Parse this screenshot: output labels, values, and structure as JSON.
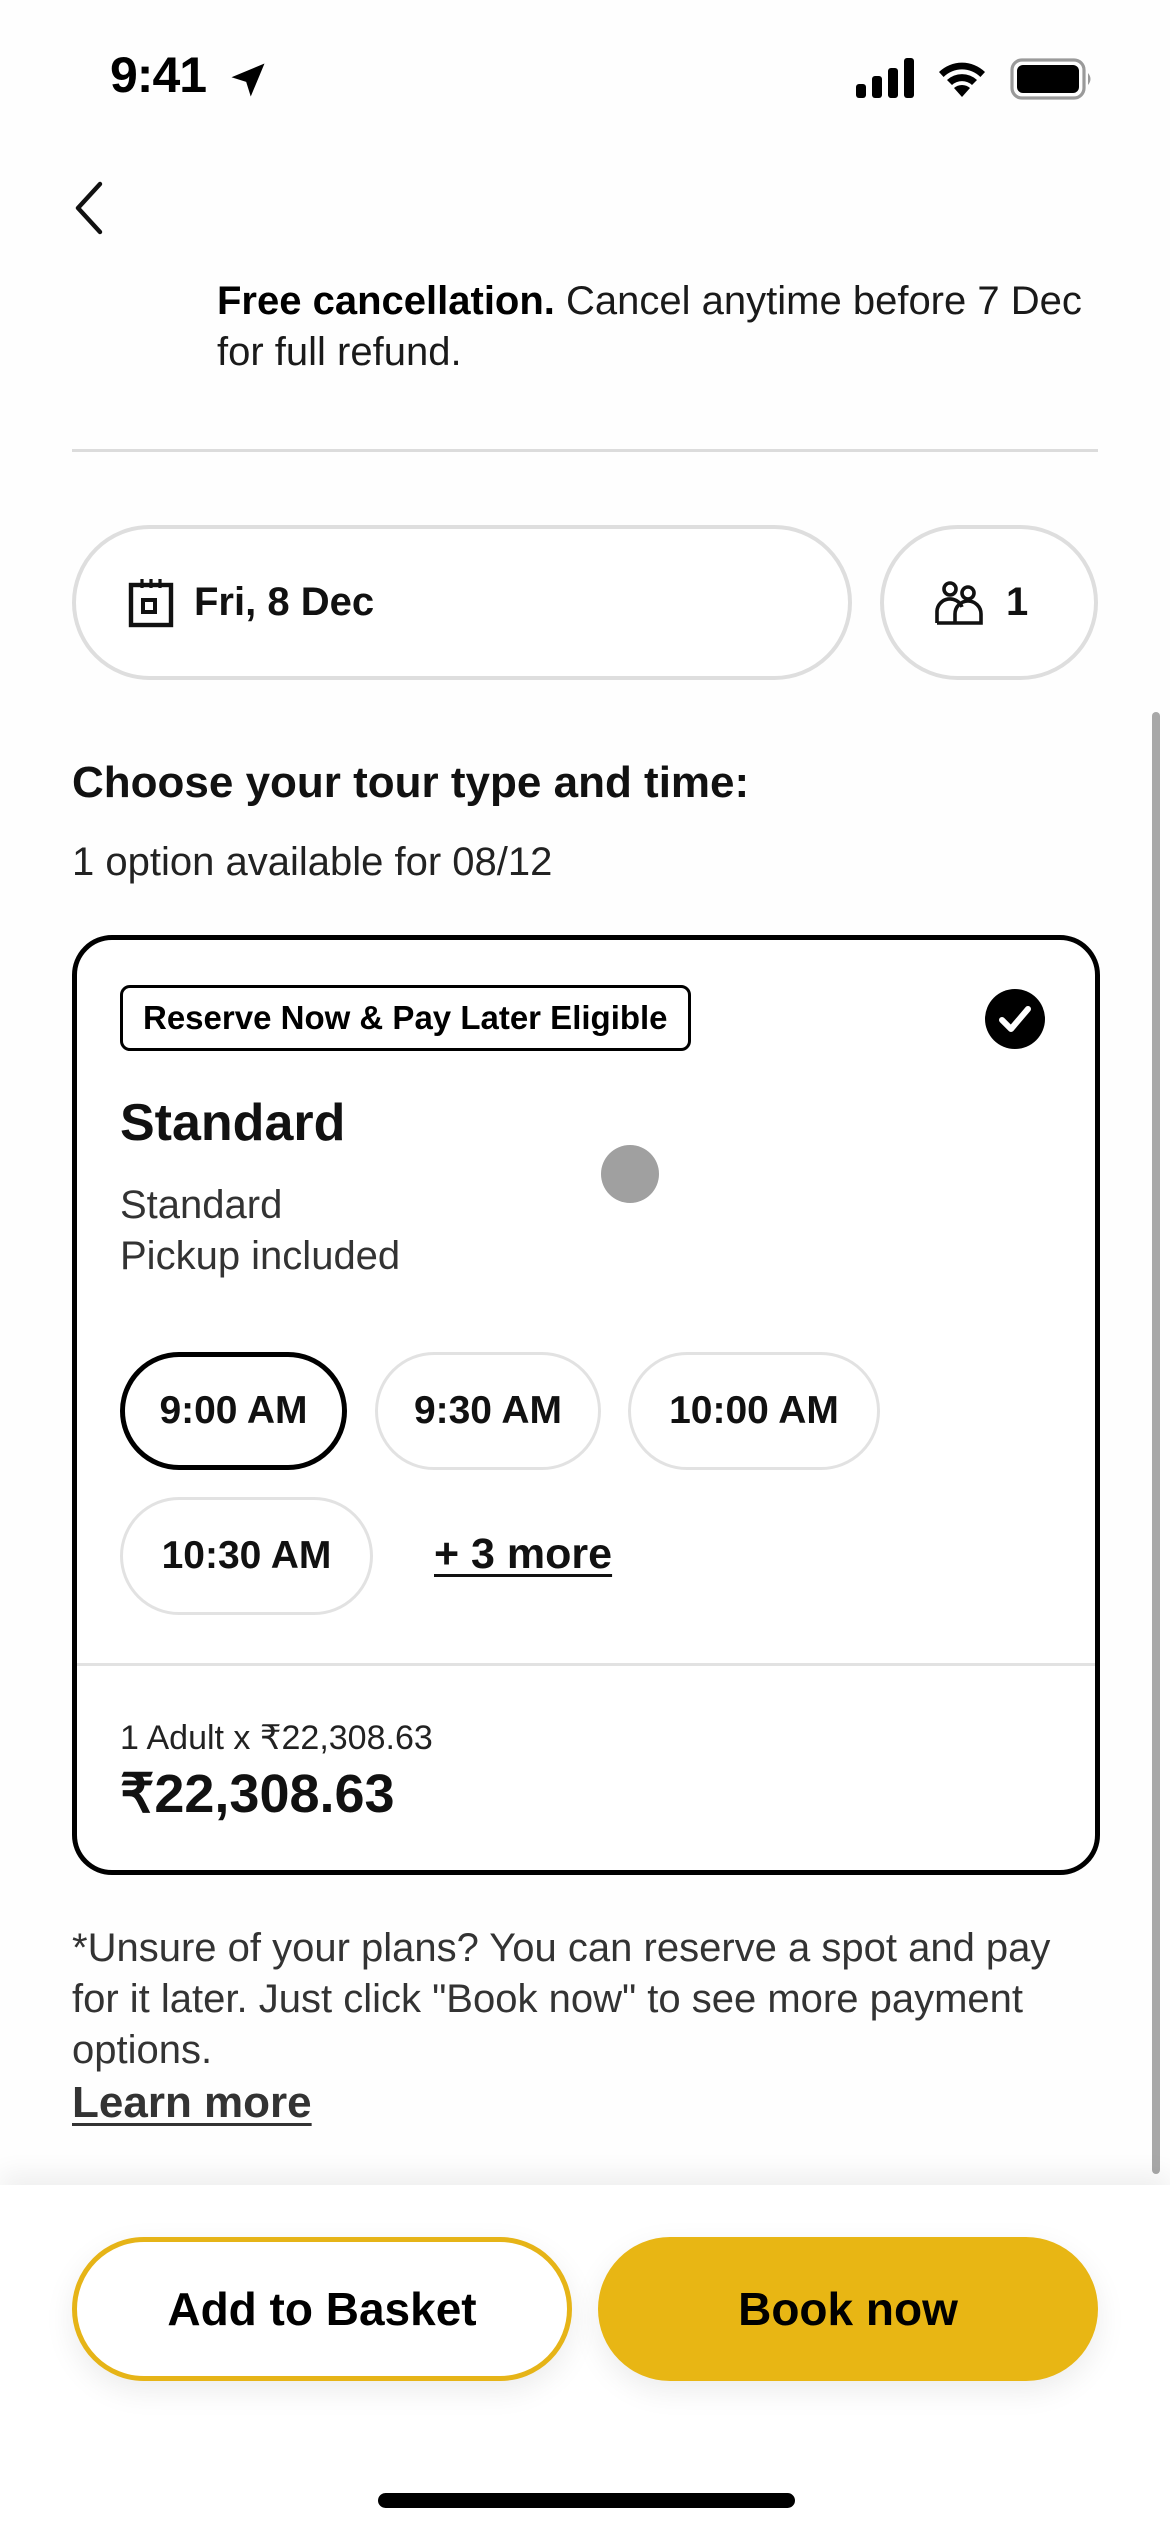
{
  "status_bar": {
    "time": "9:41",
    "icons": [
      "location-arrow-icon",
      "cellular-signal-icon",
      "wifi-icon",
      "battery-icon"
    ]
  },
  "nav": {
    "back_icon": "chevron-left-icon"
  },
  "cancellation": {
    "bold": "Free cancellation.",
    "text": " Cancel anytime before 7 Dec for full refund."
  },
  "selectors": {
    "date": {
      "icon": "calendar-icon",
      "label": "Fri, 8 Dec"
    },
    "travelers": {
      "icon": "people-icon",
      "count": "1"
    }
  },
  "section": {
    "title": "Choose your tour type and time:",
    "subtitle": "1 option available for 08/12"
  },
  "option": {
    "badge": "Reserve Now & Pay Later Eligible",
    "selected": true,
    "title": "Standard",
    "description_lines": [
      "Standard",
      "Pickup included"
    ],
    "times": [
      {
        "label": "9:00 AM",
        "selected": true
      },
      {
        "label": "9:30 AM",
        "selected": false
      },
      {
        "label": "10:00 AM",
        "selected": false
      },
      {
        "label": "10:30 AM",
        "selected": false
      }
    ],
    "more_label": "+ 3 more",
    "price_detail": "1 Adult x ₹22,308.63",
    "price_total": "₹22,308.63"
  },
  "footnote": {
    "text": "*Unsure of your plans? You can reserve a spot and pay for it later. Just click \"Book now\" to see more payment options.",
    "link": "Learn more"
  },
  "actions": {
    "add_to_basket": "Add to Basket",
    "book_now": "Book now"
  },
  "colors": {
    "accent": "#e8b614",
    "text": "#111111",
    "border_light": "#dedede"
  }
}
